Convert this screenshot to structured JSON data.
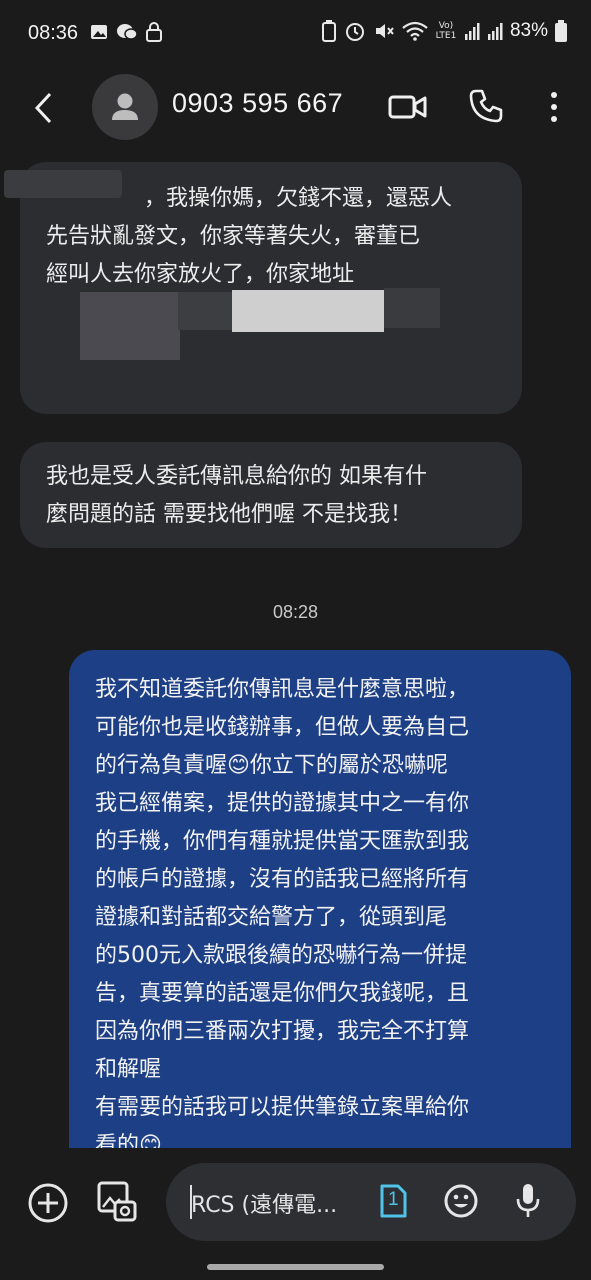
{
  "status_bar": {
    "time": "08:36",
    "battery": "83%",
    "network_label": "Vo) LTE1"
  },
  "header": {
    "contact": "0903 595 667"
  },
  "messages": [
    {
      "direction": "incoming",
      "lines": [
        "，我操你媽，欠錢不還，還惡人",
        "先告狀亂發文，你家等著失火，審董已",
        "經叫人去你家放火了，你家地址"
      ]
    },
    {
      "direction": "incoming",
      "lines": [
        "我也是受人委託傳訊息給你的 如果有什",
        "麼問題的話 需要找他們喔 不是找我！"
      ]
    },
    {
      "direction": "outgoing",
      "timestamp": "08:28",
      "lines": [
        "我不知道委託你傳訊息是什麼意思啦，",
        "可能你也是收錢辦事，但做人要為自己",
        "的行為負責喔😊你立下的屬於恐嚇呢",
        "我已經備案，提供的證據其中之一有你",
        "的手機，你們有種就提供當天匯款到我",
        "的帳戶的證據，沒有的話我已經將所有",
        "證據和對話都交給警方了，從頭到尾",
        "的500元入款跟後續的恐嚇行為一併提",
        "告，真要算的話還是你們欠我錢呢，且",
        "因為你們三番兩次打擾，我完全不打算",
        "和解喔",
        "有需要的話我可以提供筆錄立案單給你",
        "看的😊"
      ]
    }
  ],
  "composer": {
    "placeholder": "RCS (遠傳電...",
    "sim_slot": "1"
  },
  "colors": {
    "background": "#1b1b1c",
    "incoming_bubble": "#2c2d31",
    "outgoing_bubble": "#1d3f86",
    "sim_accent": "#4fc3e8"
  }
}
